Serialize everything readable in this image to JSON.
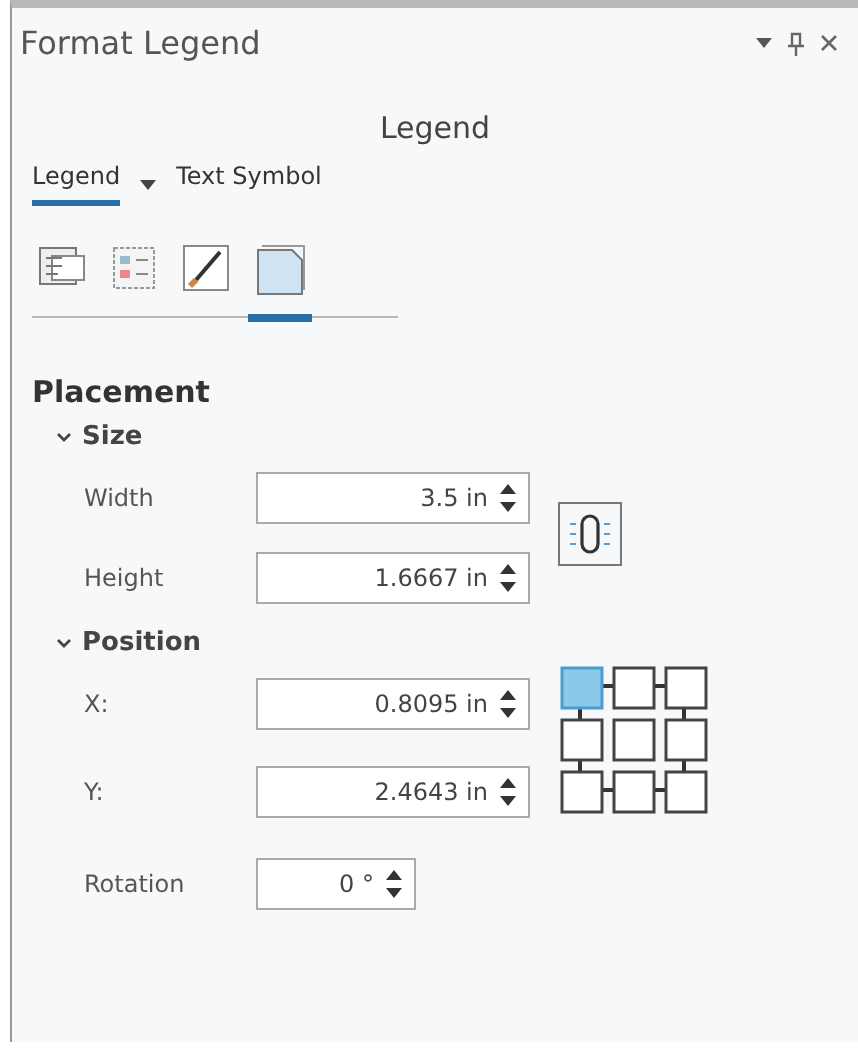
{
  "window": {
    "title": "Format Legend"
  },
  "header": "Legend",
  "tabs": [
    {
      "label": "Legend",
      "selected": true
    },
    {
      "label": "Text Symbol",
      "selected": false
    }
  ],
  "icon_tabs": [
    {
      "selected": false
    },
    {
      "selected": false
    },
    {
      "selected": false
    },
    {
      "selected": true
    }
  ],
  "section": "Placement",
  "size": {
    "label": "Size",
    "expanded": true,
    "fields": [
      {
        "label": "Width",
        "value": "3.5 in"
      },
      {
        "label": "Height",
        "value": "1.6667 in"
      }
    ]
  },
  "position": {
    "label": "Position",
    "expanded": true,
    "fields": [
      {
        "label": "X:",
        "value": "0.8095 in"
      },
      {
        "label": "Y:",
        "value": "2.4643 in"
      }
    ],
    "anchor_points": [
      {
        "selected": true
      },
      {
        "selected": false
      },
      {
        "selected": false
      },
      {
        "selected": false
      },
      {
        "selected": false
      },
      {
        "selected": false
      },
      {
        "selected": false
      },
      {
        "selected": false
      },
      {
        "selected": false
      }
    ]
  },
  "rotation": {
    "label": "Rotation",
    "value": "0 °"
  }
}
